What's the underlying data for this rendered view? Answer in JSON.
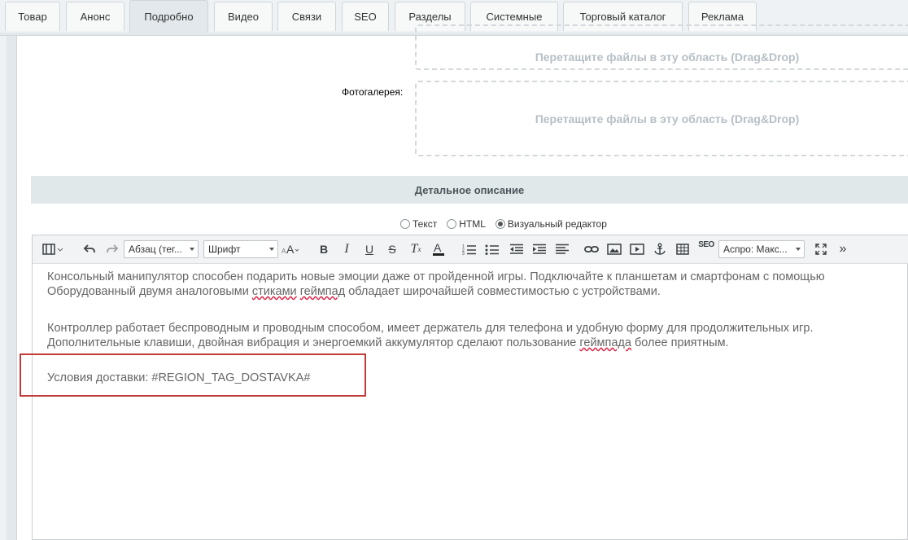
{
  "tabs": [
    {
      "label": "Товар"
    },
    {
      "label": "Анонс"
    },
    {
      "label": "Подробно",
      "active": true
    },
    {
      "label": "Видео"
    },
    {
      "label": "Связи"
    },
    {
      "label": "SEO"
    },
    {
      "label": "Разделы"
    },
    {
      "label": "Системные"
    },
    {
      "label": "Торговый каталог"
    },
    {
      "label": "Реклама"
    }
  ],
  "dropzone_top": {
    "text": "Перетащите файлы в эту область (Drag&Drop)"
  },
  "gallery": {
    "label": "Фотогалерея:",
    "dropzone_text": "Перетащите файлы в эту область (Drag&Drop)"
  },
  "section": {
    "title": "Детальное описание"
  },
  "editor_modes": [
    {
      "label": "Текст",
      "selected": false
    },
    {
      "label": "HTML",
      "selected": false
    },
    {
      "label": "Визуальный редактор",
      "selected": true
    }
  ],
  "toolbar": {
    "format_select": "Абзац (тег...",
    "font_select": "Шрифт",
    "style_select": "Аспро: Макс...",
    "icons": [
      "view-mode-icon",
      "undo-icon",
      "redo-icon",
      "font-size-icon",
      "bold-icon",
      "italic-icon",
      "underline-icon",
      "strikethrough-icon",
      "remove-format-icon",
      "text-color-icon",
      "ordered-list-icon",
      "unordered-list-icon",
      "outdent-icon",
      "indent-icon",
      "align-icon",
      "link-icon",
      "image-icon",
      "video-icon",
      "anchor-icon",
      "table-icon",
      "seo-icon",
      "fullscreen-icon",
      "more-icon"
    ]
  },
  "content": {
    "p1_line1": "Консольный манипулятор способен подарить новые эмоции даже от пройденной игры. Подключайте к планшетам и смартфонам с помощью",
    "p1_line2_a": "Оборудованный двумя аналоговыми ",
    "p1_line2_b": "стиками",
    "p1_line2_c": " ",
    "p1_line2_d": "геймпад",
    "p1_line2_e": " обладает широчайшей совместимостью с устройствами.",
    "p2_line1": "Контроллер работает беспроводным и проводным способом, имеет держатель для телефона и удобную форму для продолжительных игр.",
    "p2_line2_a": "Дополнительные клавиши, двойная вибрация и энергоемкий аккумулятор сделают пользование ",
    "p2_line2_b": "геймпада",
    "p2_line2_c": " более приятным.",
    "p3": "Условия доставки: #REGION_TAG_DOSTAVKA#"
  },
  "colors": {
    "highlight": "#c23b3b",
    "spellcheck": "#dd2244"
  }
}
